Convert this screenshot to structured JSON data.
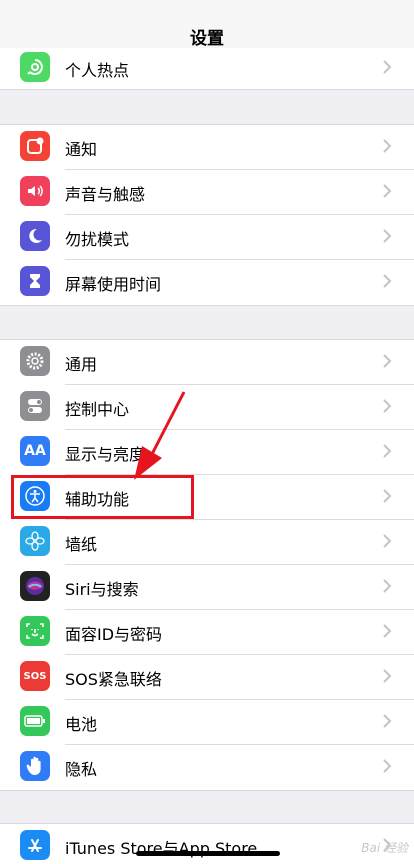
{
  "header": {
    "title": "设置"
  },
  "groups": [
    {
      "items": [
        {
          "label": "个人热点",
          "icon": "hotspot-icon",
          "color": "#4cd964"
        }
      ]
    },
    {
      "items": [
        {
          "label": "通知",
          "icon": "notifications-icon",
          "color": "#f44336"
        },
        {
          "label": "声音与触感",
          "icon": "sound-icon",
          "color": "#f0405b"
        },
        {
          "label": "勿扰模式",
          "icon": "moon-icon",
          "color": "#5856d6"
        },
        {
          "label": "屏幕使用时间",
          "icon": "hourglass-icon",
          "color": "#5856d6"
        }
      ]
    },
    {
      "items": [
        {
          "label": "通用",
          "icon": "gear-icon",
          "color": "#8e8e93"
        },
        {
          "label": "控制中心",
          "icon": "toggles-icon",
          "color": "#8e8e93"
        },
        {
          "label": "显示与亮度",
          "icon": "display-icon",
          "color": "#2f7cf6"
        },
        {
          "label": "辅助功能",
          "icon": "accessibility-icon",
          "color": "#1a7cf5"
        },
        {
          "label": "墙纸",
          "icon": "wallpaper-icon",
          "color": "#2aa9e6"
        },
        {
          "label": "Siri与搜索",
          "icon": "siri-icon",
          "color": "#222222"
        },
        {
          "label": "面容ID与密码",
          "icon": "faceid-icon",
          "color": "#34c759"
        },
        {
          "label": "SOS紧急联络",
          "icon": "sos-icon",
          "color": "#ec3b34"
        },
        {
          "label": "电池",
          "icon": "battery-icon",
          "color": "#34c759"
        },
        {
          "label": "隐私",
          "icon": "hand-icon",
          "color": "#2f7cf6"
        }
      ]
    },
    {
      "items": [
        {
          "label": "iTunes Store与App Store",
          "icon": "appstore-icon",
          "color": "#1b8cf6"
        }
      ]
    }
  ],
  "annotation": {
    "highlight_color": "#e5141e"
  },
  "watermark": {
    "text": "Bai 经验"
  }
}
